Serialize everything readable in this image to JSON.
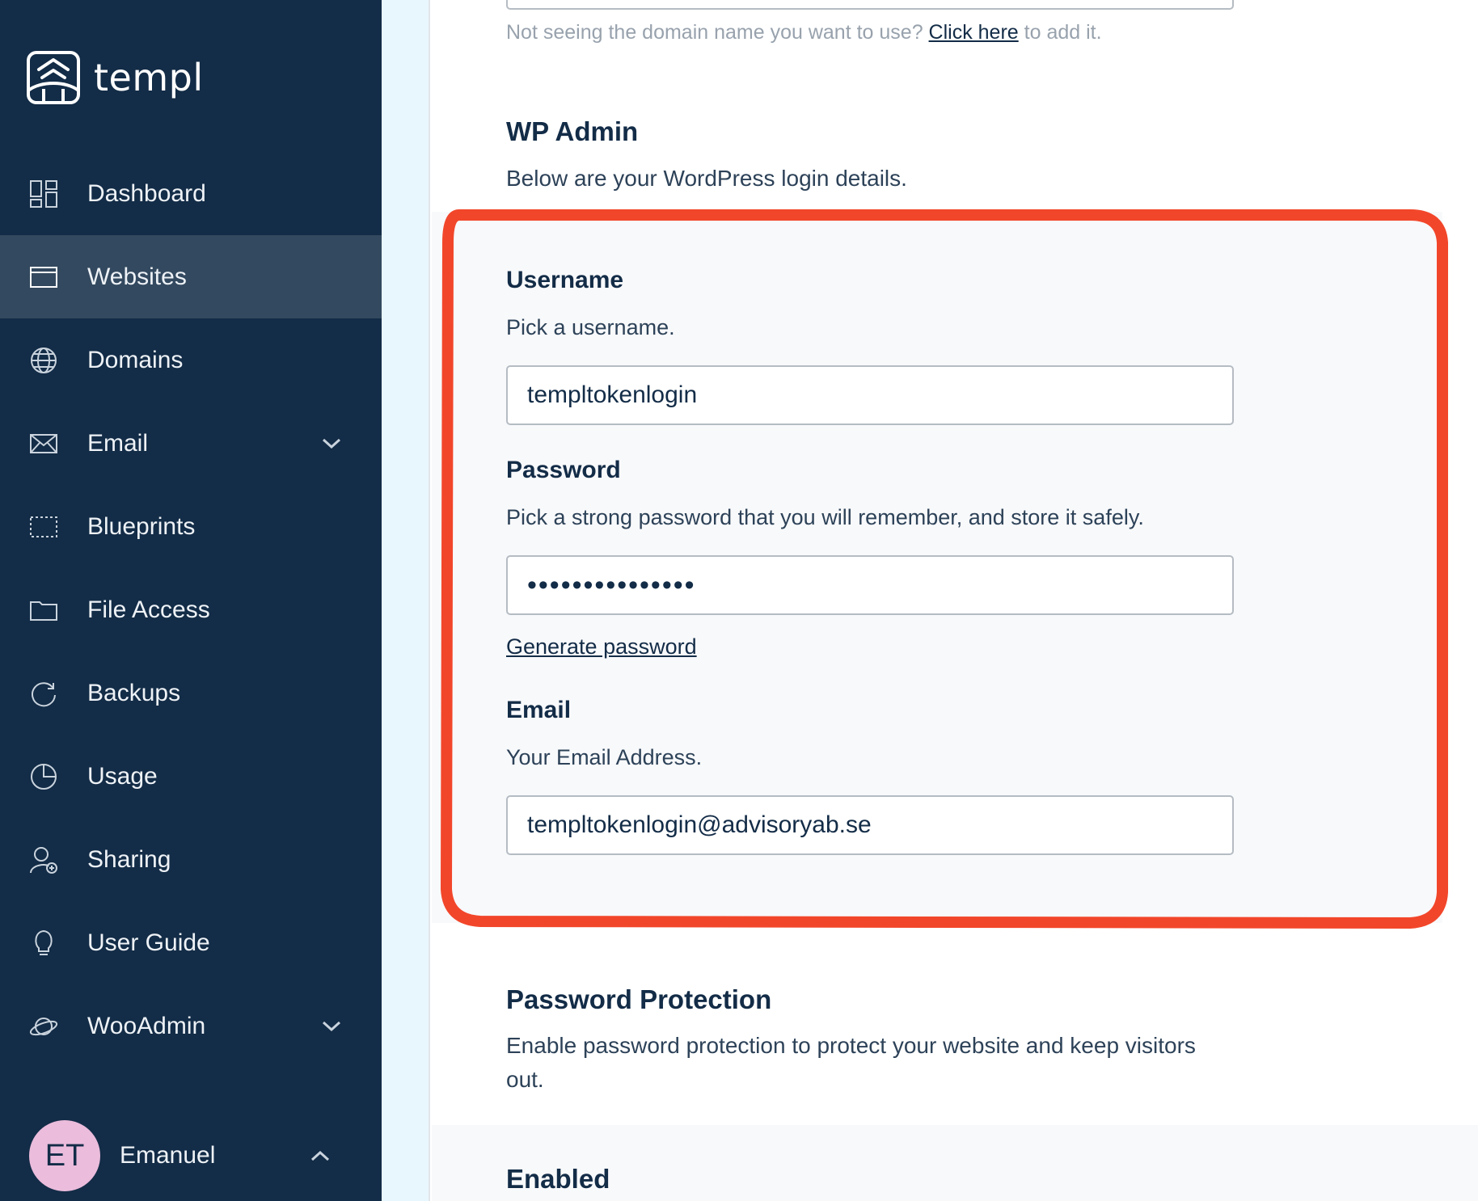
{
  "sidebar": {
    "brand": "templ",
    "items": [
      {
        "label": "Dashboard",
        "icon": "dashboard-icon"
      },
      {
        "label": "Websites",
        "icon": "browser-window-icon",
        "active": true
      },
      {
        "label": "Domains",
        "icon": "globe-icon"
      },
      {
        "label": "Email",
        "icon": "envelope-icon",
        "expandable": true
      },
      {
        "label": "Blueprints",
        "icon": "blueprint-icon"
      },
      {
        "label": "File Access",
        "icon": "folder-icon"
      },
      {
        "label": "Backups",
        "icon": "refresh-icon"
      },
      {
        "label": "Usage",
        "icon": "pie-chart-icon"
      },
      {
        "label": "Sharing",
        "icon": "user-add-icon"
      },
      {
        "label": "User Guide",
        "icon": "lightbulb-icon"
      },
      {
        "label": "WooAdmin",
        "icon": "planet-icon",
        "expandable": true
      }
    ],
    "user": {
      "initials": "ET",
      "name": "Emanuel"
    }
  },
  "main": {
    "domain_hint": {
      "before": "Not seeing the domain name you want to use? ",
      "link": "Click here",
      "after": " to add it."
    },
    "wp_admin": {
      "title": "WP Admin",
      "description": "Below are your WordPress login details."
    },
    "username": {
      "label": "Username",
      "description": "Pick a username.",
      "value": "templtokenlogin"
    },
    "password": {
      "label": "Password",
      "description": "Pick a strong password that you will remember, and store it safely.",
      "value": "•••••••••••••••",
      "generate_label": "Generate password"
    },
    "email": {
      "label": "Email",
      "description": "Your Email Address.",
      "value": "templtokenlogin@advisoryab.se"
    },
    "password_protection": {
      "title": "Password Protection",
      "description_line1": "Enable password protection to protect your website and keep visitors",
      "description_line2": "out."
    },
    "enabled": {
      "title": "Enabled"
    }
  },
  "colors": {
    "sidebar_bg": "#132c47",
    "sidebar_active": "#33495f",
    "highlight": "#f2462a",
    "avatar_bg": "#ebbcdc",
    "text_dark": "#132c47"
  }
}
